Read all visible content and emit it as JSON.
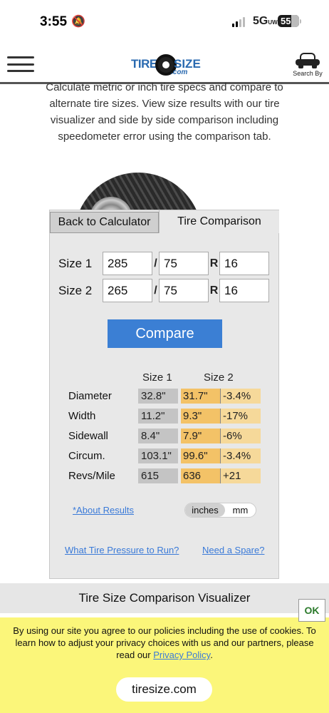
{
  "status_bar": {
    "time": "3:55",
    "network": "5G",
    "network_sup": "UW",
    "battery": "55"
  },
  "header": {
    "logo_tire": "TIRE",
    "logo_size": "SIZE",
    "logo_com": ".com",
    "search_by": "Search By"
  },
  "intro": "Calculate metric or inch tire specs and compare to alternate tire sizes. View size results with our tire visualizer and side by side comparison including speedometer error using the comparison tab.",
  "tabs": {
    "back": "Back to Calculator",
    "active": "Tire Comparison"
  },
  "size1": {
    "label": "Size 1",
    "width": "285",
    "ratio": "75",
    "rim": "16"
  },
  "size2": {
    "label": "Size 2",
    "width": "265",
    "ratio": "75",
    "rim": "16"
  },
  "separators": {
    "slash": "/",
    "r": "R"
  },
  "compare_label": "Compare",
  "results": {
    "col1": "Size 1",
    "col2": "Size 2",
    "rows": [
      {
        "label": "Diameter",
        "s1": "32.8\"",
        "s2": "31.7\"",
        "diff": "-3.4%"
      },
      {
        "label": "Width",
        "s1": "11.2\"",
        "s2": "9.3\"",
        "diff": "-17%"
      },
      {
        "label": "Sidewall",
        "s1": "8.4\"",
        "s2": "7.9\"",
        "diff": "-6%"
      },
      {
        "label": "Circum.",
        "s1": "103.1\"",
        "s2": "99.6\"",
        "diff": "-3.4%"
      },
      {
        "label": "Revs/Mile",
        "s1": "615",
        "s2": "636",
        "diff": "+21"
      }
    ]
  },
  "links": {
    "about": "*About Results",
    "pressure": "What Tire Pressure to Run?",
    "spare": "Need a Spare?"
  },
  "units": {
    "inches": "inches",
    "mm": "mm",
    "selected": "inches"
  },
  "visualizer_title": "Tire Size Comparison Visualizer",
  "cookie": {
    "text": "By using our site you agree to our policies including the use of cookies. To learn how to adjust your privacy choices with us and our partners, please read our",
    "link": "Privacy Policy",
    "end": ".",
    "ok": "OK"
  },
  "url": "tiresize.com",
  "colors": {
    "accent": "#3b7fd4",
    "size2_cell": "#f3c267",
    "diff_cell": "#f6d99a",
    "cookie_bg": "#fbf67a"
  }
}
